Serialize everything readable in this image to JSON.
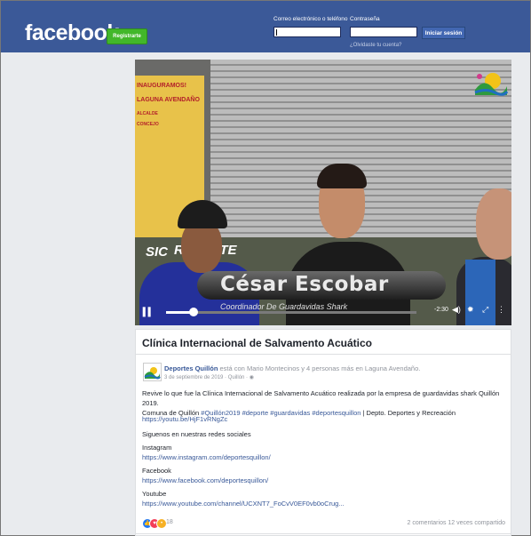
{
  "header": {
    "logo": "facebook",
    "register_label": "Registrarte",
    "email_label": "Correo electrónico o teléfono",
    "password_label": "Contraseña",
    "login_label": "Iniciar sesión",
    "forgot_link": "¿Olvidaste tu cuenta?",
    "brand_color": "#3b5998"
  },
  "video": {
    "name_overlay": "César Escobar",
    "role_overlay": "Coordinador De Guardavidas Shark",
    "vest_text_left": "SIC",
    "vest_text_right": "RESCATE",
    "sign_lines": [
      "INAUGURAMOS!",
      "LAGUNA AVENDAÑO",
      "ALCALDE",
      "CONCEJO"
    ],
    "time_remaining": "-2:30",
    "progress": 0.11
  },
  "post": {
    "title": "Clínica Internacional de Salvamento Acuático",
    "page_name": "Deportes Quillón",
    "poster_rest": " está con Mario Montecinos y 4 personas más en Laguna Avendaño.",
    "meta": "3 de septiembre de 2019 · Quillón · ",
    "body_line1": "Revive lo que fue la Clínica Internacional de Salvamento Acuático realizada por la empresa de guardavidas shark Quillón 2019.",
    "body_line2_start": "Comuna de Quillón ",
    "body_hashtags": "#Quillón2019 #deporte #guardavidas #deportesquillon",
    "body_line2_end": " | Depto. Deportes y Recreación",
    "youtu_link": "https://youtu.be/HjF1vRNgZc",
    "follow_text": "Siguenos en nuestras redes sociales",
    "instagram_label": "Instagram",
    "instagram_link": "https://www.instagram.com/deportesquillon/",
    "facebook_label": "Facebook",
    "facebook_link": "https://www.facebook.com/deportesquillon/",
    "youtube_label": "Youtube",
    "youtube_link": "https://www.youtube.com/channel/UCXNT7_FoCvV0EF0vb0oCrug...",
    "reaction_count": "18",
    "stats": "2 comentarios  12 veces compartido"
  }
}
